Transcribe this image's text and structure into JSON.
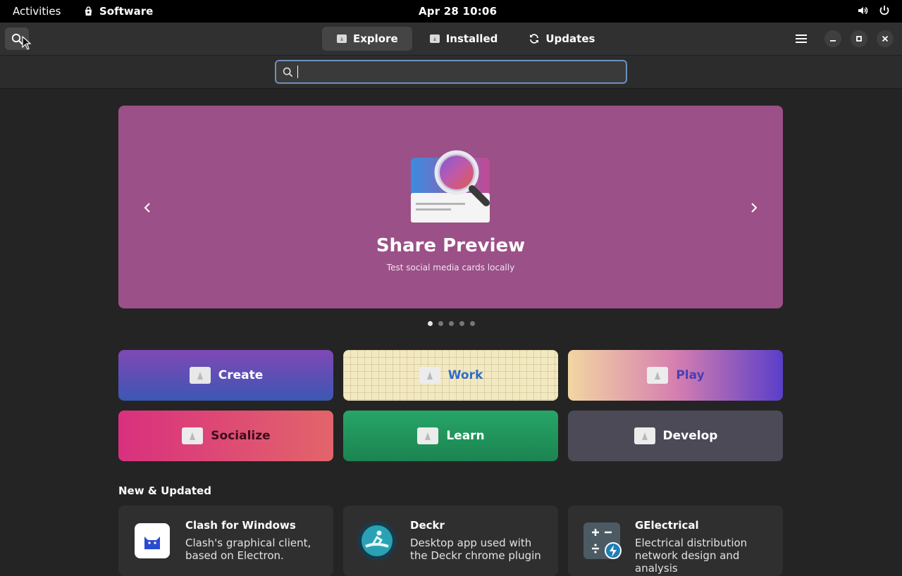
{
  "topbar": {
    "activities": "Activities",
    "app_name": "Software",
    "clock": "Apr 28  10:06",
    "icons": [
      "volume-icon",
      "power-icon"
    ]
  },
  "header": {
    "tabs": [
      {
        "label": "Explore",
        "icon": "explore-icon",
        "active": true
      },
      {
        "label": "Installed",
        "icon": "installed-icon",
        "active": false
      },
      {
        "label": "Updates",
        "icon": "refresh-icon",
        "active": false
      }
    ],
    "controls": [
      "menu-icon",
      "minimize-icon",
      "maximize-icon",
      "close-icon"
    ]
  },
  "search": {
    "value": "",
    "placeholder": ""
  },
  "featured": {
    "title": "Share Preview",
    "subtitle": "Test social media cards locally",
    "accent": "#9b5088",
    "slide_count": 5,
    "active_slide": 1
  },
  "categories": [
    {
      "label": "Create"
    },
    {
      "label": "Work"
    },
    {
      "label": "Play"
    },
    {
      "label": "Socialize"
    },
    {
      "label": "Learn"
    },
    {
      "label": "Develop"
    }
  ],
  "new_updated": {
    "title": "New & Updated",
    "apps": [
      {
        "name": "Clash for Windows",
        "description": "Clash's graphical client, based on Electron.",
        "icon": "clash-cat-icon"
      },
      {
        "name": "Deckr",
        "description": "Desktop app used with the Deckr chrome plugin",
        "icon": "deckr-surfer-icon"
      },
      {
        "name": "GElectrical",
        "description": "Electrical distribution network design and analysis",
        "icon": "gelectrical-icon"
      }
    ]
  }
}
